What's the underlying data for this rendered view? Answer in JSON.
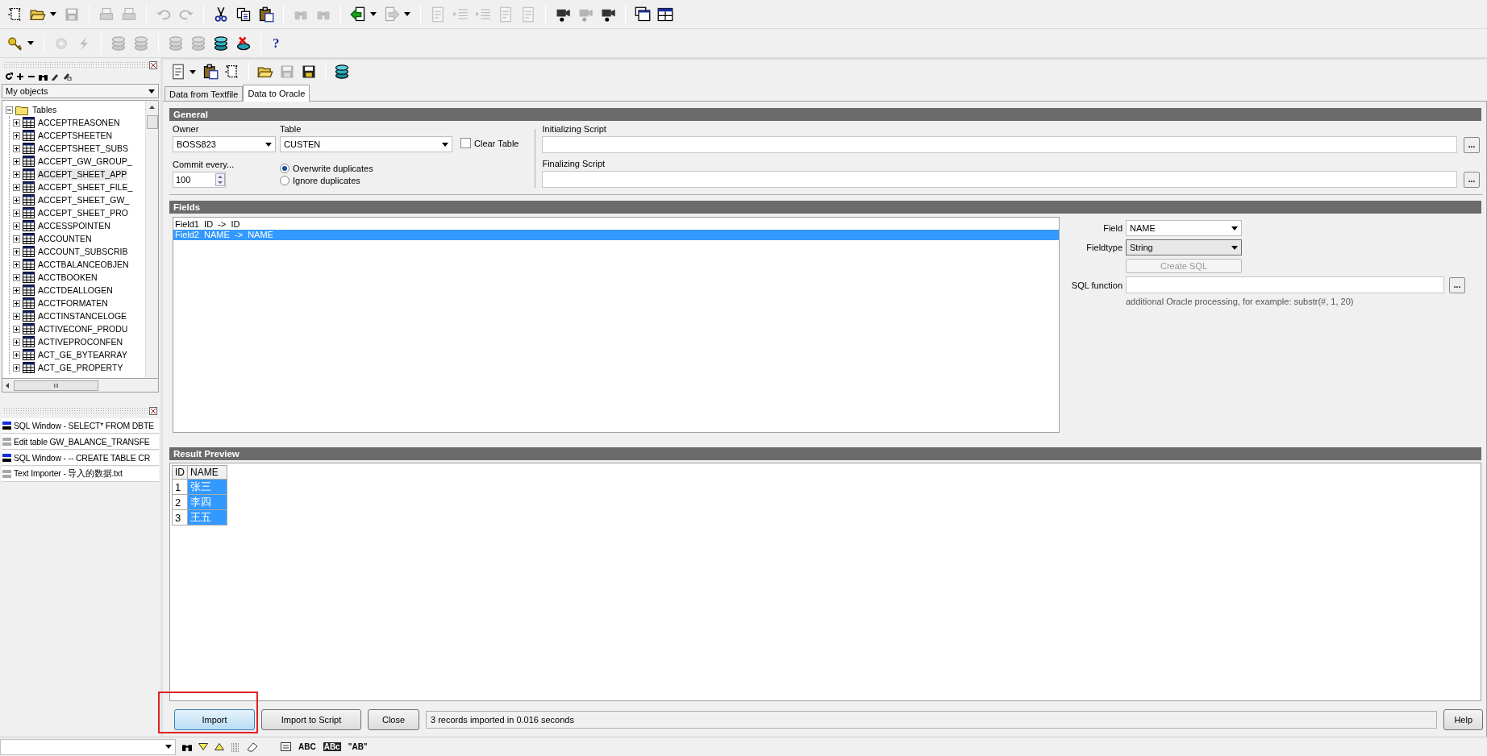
{
  "main_toolbar": [
    [
      {
        "disabled": false
      },
      {
        "disabled": false
      },
      {
        "disabled": true
      }
    ],
    [
      {
        "disabled": true
      },
      {
        "disabled": true
      }
    ],
    [
      {
        "disabled": true
      },
      {
        "disabled": true
      }
    ],
    [
      {
        "disabled": false
      },
      {
        "disabled": false
      },
      {
        "disabled": false
      }
    ],
    [
      {
        "disabled": true
      },
      {
        "disabled": true
      }
    ],
    [
      {
        "disabled": false
      },
      {
        "disabled": true
      }
    ],
    [
      {
        "disabled": true
      },
      {
        "disabled": true
      },
      {
        "disabled": true
      },
      {
        "disabled": true
      },
      {
        "disabled": true
      }
    ],
    [
      {
        "disabled": false
      },
      {
        "disabled": true
      },
      {
        "disabled": false
      }
    ],
    [
      {
        "disabled": false
      },
      {
        "disabled": false
      }
    ]
  ],
  "second_toolbar": [
    [
      {
        "disabled": false
      }
    ],
    [
      {
        "disabled": true
      },
      {
        "disabled": true
      }
    ],
    [
      {
        "disabled": true
      },
      {
        "disabled": true
      }
    ],
    [
      {
        "disabled": true
      },
      {
        "disabled": true
      },
      {
        "disabled": false
      },
      {
        "disabled": false
      }
    ]
  ],
  "help_button": {
    "label": "?"
  },
  "object_browser": {
    "filter": "My objects",
    "tree": [
      {
        "label": "Tables",
        "expanded": true,
        "children": [
          {
            "label": "ACCEPTREASONEN",
            "expanded": false,
            "selected": false
          },
          {
            "label": "ACCEPTSHEETEN",
            "expanded": false,
            "selected": false
          },
          {
            "label": "ACCEPTSHEET_SUBS",
            "expanded": false,
            "selected": false
          },
          {
            "label": "ACCEPT_GW_GROUP_",
            "expanded": false,
            "selected": false
          },
          {
            "label": "ACCEPT_SHEET_APP",
            "expanded": false,
            "selected": true
          },
          {
            "label": "ACCEPT_SHEET_FILE_",
            "expanded": false,
            "selected": false
          },
          {
            "label": "ACCEPT_SHEET_GW_",
            "expanded": false,
            "selected": false
          },
          {
            "label": "ACCEPT_SHEET_PRO",
            "expanded": false,
            "selected": false
          },
          {
            "label": "ACCESSPOINTEN",
            "expanded": false,
            "selected": false
          },
          {
            "label": "ACCOUNTEN",
            "expanded": false,
            "selected": false
          },
          {
            "label": "ACCOUNT_SUBSCRIB",
            "expanded": false,
            "selected": false
          },
          {
            "label": "ACCTBALANCEOBJEN",
            "expanded": false,
            "selected": false
          },
          {
            "label": "ACCTBOOKEN",
            "expanded": false,
            "selected": false
          },
          {
            "label": "ACCTDEALLOGEN",
            "expanded": false,
            "selected": false
          },
          {
            "label": "ACCTFORMATEN",
            "expanded": false,
            "selected": false
          },
          {
            "label": "ACCTINSTANCELOGE",
            "expanded": false,
            "selected": false
          },
          {
            "label": "ACTIVECONF_PRODU",
            "expanded": false,
            "selected": false
          },
          {
            "label": "ACTIVEPROCONFEN",
            "expanded": false,
            "selected": false
          },
          {
            "label": "ACT_GE_BYTEARRAY",
            "expanded": false,
            "selected": false
          },
          {
            "label": "ACT_GE_PROPERTY",
            "expanded": false,
            "selected": false
          }
        ]
      }
    ],
    "scroll_mark": "III"
  },
  "window_list": [
    {
      "kind": "sql",
      "title": "SQL Window - SELECT* FROM DBTE"
    },
    {
      "kind": "table",
      "title": "Edit table GW_BALANCE_TRANSFE"
    },
    {
      "kind": "sql",
      "title": "SQL Window - -- CREATE TABLE CR"
    },
    {
      "kind": "table",
      "title": "Text Importer - 导入的数据.txt"
    }
  ],
  "importer_toolbar": [
    [
      {
        "disabled": false
      },
      {
        "disabled": false
      },
      {
        "disabled": false
      }
    ],
    [
      {
        "disabled": false
      },
      {
        "disabled": true
      },
      {
        "disabled": false
      }
    ],
    [
      {
        "disabled": false
      }
    ]
  ],
  "tabs": [
    {
      "label": "Data from Textfile",
      "selected": false
    },
    {
      "label": "Data to Oracle",
      "selected": true
    }
  ],
  "general": {
    "title": "General",
    "owner_label": "Owner",
    "owner": "BOSS823",
    "table_label": "Table",
    "table": "CUSTEN",
    "clear_table": {
      "label": "Clear Table",
      "checked": false
    },
    "commit_label": "Commit every...",
    "commit": "100",
    "duplicates": [
      {
        "label": "Overwrite duplicates",
        "selected": true
      },
      {
        "label": "Ignore duplicates",
        "selected": false
      }
    ],
    "initializing_label": "Initializing Script",
    "finalizing_label": "Finalizing Script",
    "browse": "..."
  },
  "fields": {
    "title": "Fields",
    "list": [
      {
        "label": "Field1  ID  ->  ID",
        "selected": false
      },
      {
        "label": "Field2  NAME  ->  NAME",
        "selected": true
      }
    ],
    "field_label": "Field",
    "field": "NAME",
    "fieldtype_label": "Fieldtype",
    "fieldtype": "String",
    "create_sql": {
      "label": "Create SQL",
      "disabled": true
    },
    "sql_function_label": "SQL function",
    "browse": "...",
    "hint": "additional Oracle processing, for example: substr(#, 1, 20)"
  },
  "result_preview": {
    "title": "Result Preview",
    "columns": [
      "ID",
      "NAME"
    ],
    "rows": [
      {
        "id": "1",
        "name": "张三",
        "selected": true
      },
      {
        "id": "2",
        "name": "李四",
        "selected": true
      },
      {
        "id": "3",
        "name": "王五",
        "selected": true
      }
    ]
  },
  "buttons": [
    {
      "label": "Import",
      "highlighted": true
    },
    {
      "label": "Import to Script",
      "highlighted": false
    },
    {
      "label": "Close",
      "highlighted": false
    }
  ],
  "status": "3 records imported in 0.016 seconds",
  "help": "Help",
  "bottom_toolbar": {
    "texts": [
      "ABC",
      "ABc",
      "\"AB\""
    ]
  }
}
